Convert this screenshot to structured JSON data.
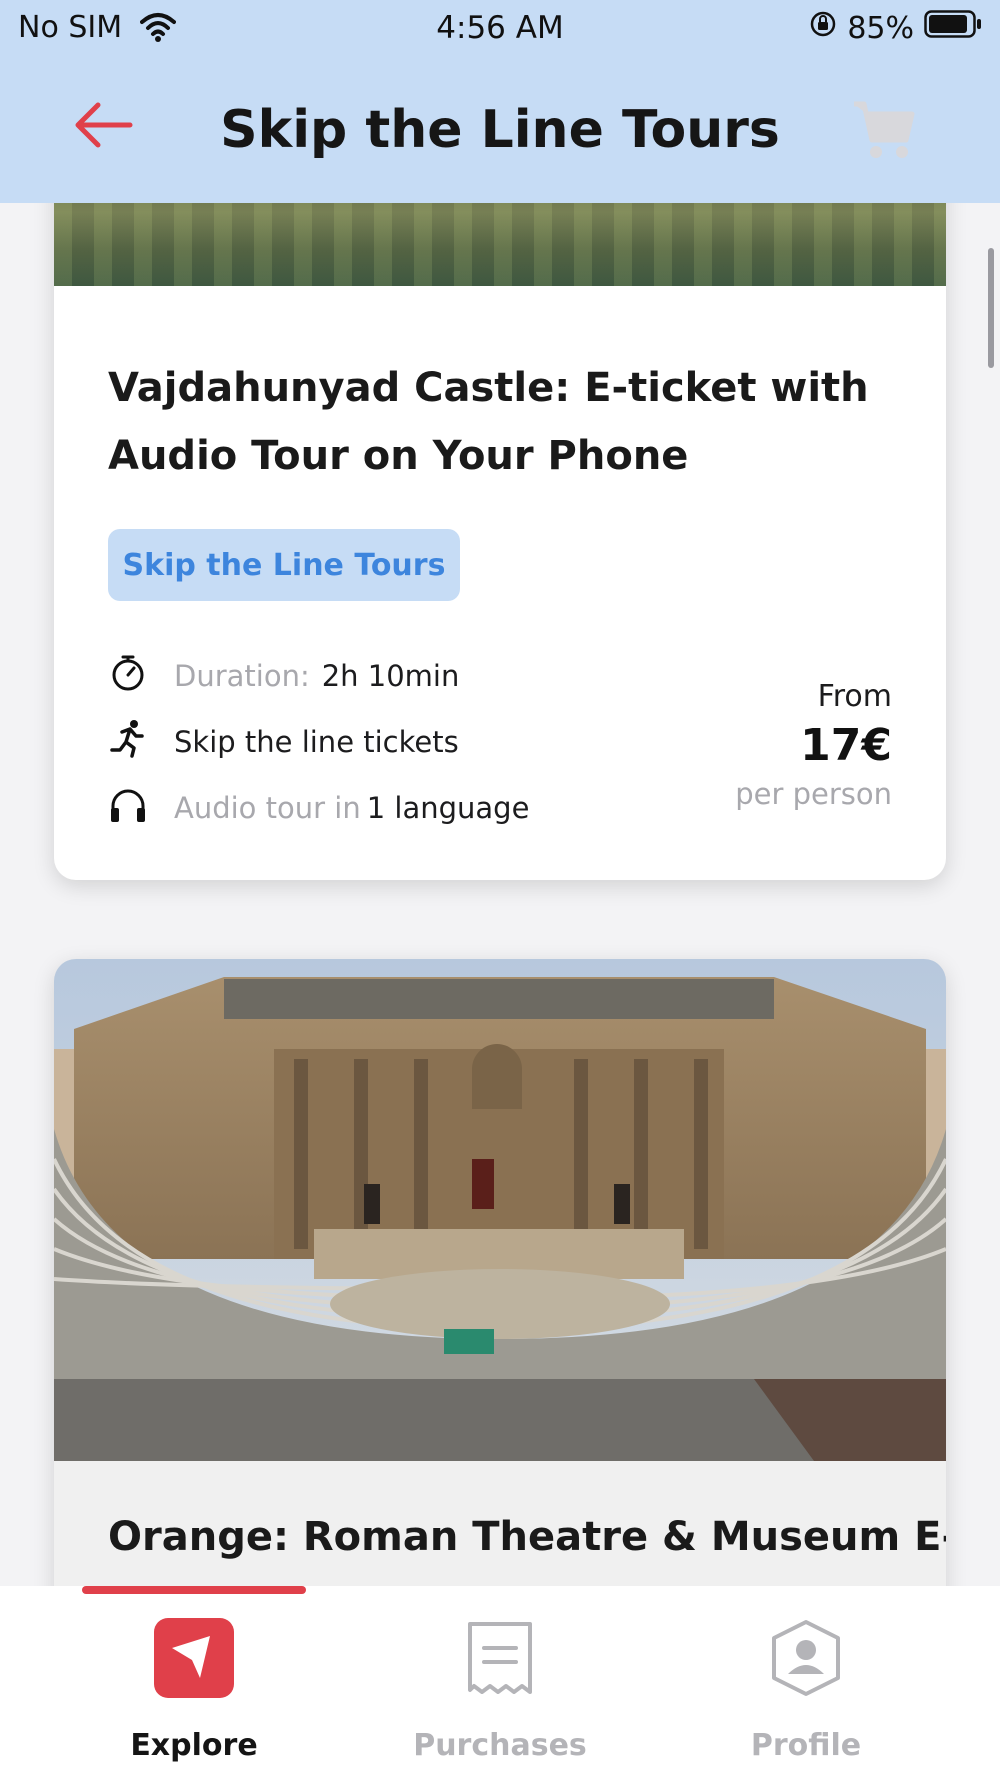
{
  "status_bar": {
    "carrier": "No SIM",
    "time": "4:56 AM",
    "battery": "85%"
  },
  "header": {
    "title": "Skip the Line Tours",
    "accent_color": "#e0404a",
    "background": "#c6dcf5"
  },
  "cards": [
    {
      "title": "Vajdahunyad Castle: E-ticket with Audio Tour on Your Phone",
      "tag": "Skip the Line Tours",
      "duration_label": "Duration:",
      "duration_value": "2h 10min",
      "skip_label": "Skip the line tickets",
      "audio_label": "Audio tour in",
      "audio_value": "1 language",
      "price_from": "From",
      "price": "17€",
      "price_unit": "per person"
    },
    {
      "title": "Orange: Roman Theatre & Museum E-"
    }
  ],
  "tabbar": {
    "explore": "Explore",
    "purchases": "Purchases",
    "profile": "Profile",
    "active": "explore"
  },
  "icons": {
    "back": "arrow-left-icon",
    "cart": "cart-icon",
    "duration": "stopwatch-icon",
    "skip": "running-person-icon",
    "audio": "headphones-icon",
    "explore": "explore-icon",
    "purchases": "receipt-icon",
    "profile": "profile-icon"
  }
}
